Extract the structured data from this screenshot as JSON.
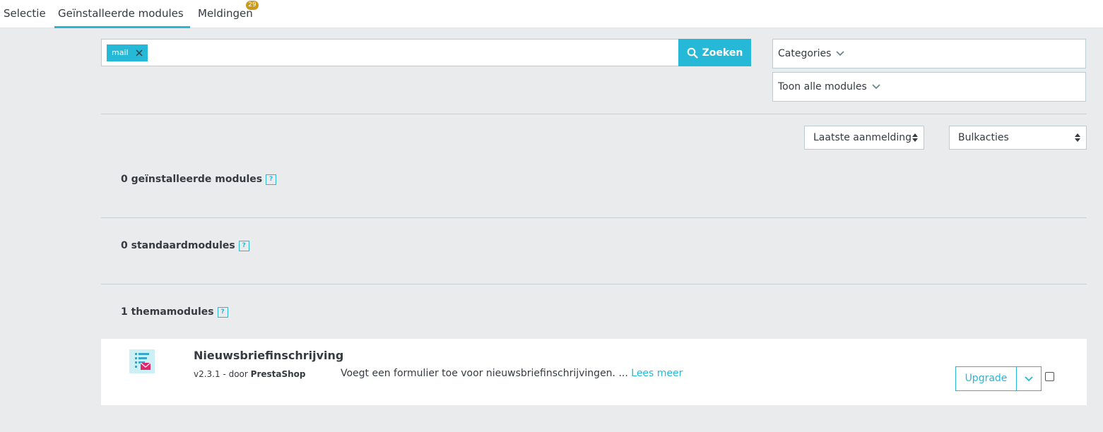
{
  "tabs": [
    {
      "label": "Selectie"
    },
    {
      "label": "Geïnstalleerde modules"
    },
    {
      "label": "Meldingen"
    }
  ],
  "notifications_count": "29",
  "search": {
    "tag": "mail",
    "button_label": "Zoeken"
  },
  "filters": {
    "categories": "Categories",
    "show": "Toon alle modules"
  },
  "sort": {
    "selected": "Laatste aanmelding"
  },
  "bulk": {
    "selected": "Bulkacties"
  },
  "sections": [
    {
      "title": "0 geïnstalleerde modules"
    },
    {
      "title": "0 standaardmodules"
    },
    {
      "title": "1 themamodules"
    }
  ],
  "help_glyph": "?",
  "module": {
    "name": "Nieuwsbriefinschrijving",
    "version_prefix": "v2.3.1 - door",
    "author": "PrestaShop",
    "description": "Voegt een formulier toe voor nieuwsbriefinschrijvingen. ...",
    "read_more": "Lees meer",
    "action": "Upgrade"
  },
  "colors": {
    "accent": "#25b9d7",
    "badge": "#c99a1b",
    "background": "#eaebec"
  }
}
